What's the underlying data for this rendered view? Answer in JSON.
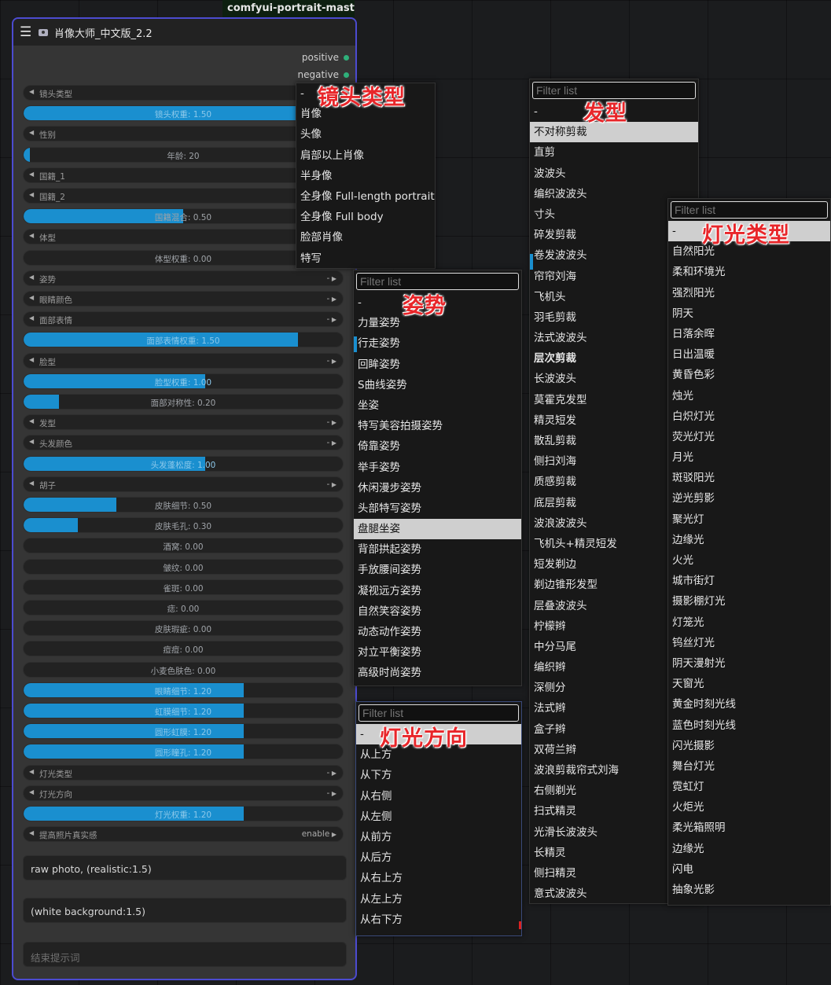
{
  "group_title": "comfyui-portrait-master..",
  "node": {
    "title": "肖像大师_中文版_2.2",
    "outputs": [
      "positive",
      "negative"
    ],
    "widgets": [
      {
        "type": "combo",
        "label": "镜头类型",
        "value": ""
      },
      {
        "type": "slider",
        "label": "镜头权重: 1.50",
        "fill": 0.86
      },
      {
        "type": "combo",
        "label": "性别",
        "value": ""
      },
      {
        "type": "slider",
        "label": "年龄: 20",
        "fill": 0.02
      },
      {
        "type": "combo",
        "label": "国籍_1",
        "value": ""
      },
      {
        "type": "combo",
        "label": "国籍_2",
        "value": ""
      },
      {
        "type": "slider",
        "label": "国籍混合: 0.50",
        "fill": 0.5
      },
      {
        "type": "combo",
        "label": "体型",
        "value": ""
      },
      {
        "type": "slider",
        "label": "体型权重: 0.00",
        "fill": 0
      },
      {
        "type": "combo",
        "label": "姿势",
        "value": "-"
      },
      {
        "type": "combo",
        "label": "眼睛颜色",
        "value": "-"
      },
      {
        "type": "combo",
        "label": "面部表情",
        "value": "-"
      },
      {
        "type": "slider",
        "label": "面部表情权重: 1.50",
        "fill": 0.86
      },
      {
        "type": "combo",
        "label": "脸型",
        "value": "-"
      },
      {
        "type": "slider",
        "label": "脸型权重: 1.00",
        "fill": 0.57
      },
      {
        "type": "slider",
        "label": "面部对称性: 0.20",
        "fill": 0.11
      },
      {
        "type": "combo",
        "label": "发型",
        "value": "-"
      },
      {
        "type": "combo",
        "label": "头发颜色",
        "value": "-"
      },
      {
        "type": "slider",
        "label": "头发蓬松度: 1.00",
        "fill": 0.57
      },
      {
        "type": "combo",
        "label": "胡子",
        "value": "-"
      },
      {
        "type": "slider",
        "label": "皮肤细节: 0.50",
        "fill": 0.29
      },
      {
        "type": "slider",
        "label": "皮肤毛孔: 0.30",
        "fill": 0.17
      },
      {
        "type": "slider",
        "label": "酒窝: 0.00",
        "fill": 0
      },
      {
        "type": "slider",
        "label": "皱纹: 0.00",
        "fill": 0
      },
      {
        "type": "slider",
        "label": "雀斑: 0.00",
        "fill": 0
      },
      {
        "type": "slider",
        "label": "痣: 0.00",
        "fill": 0
      },
      {
        "type": "slider",
        "label": "皮肤瑕疵: 0.00",
        "fill": 0
      },
      {
        "type": "slider",
        "label": "痘痘: 0.00",
        "fill": 0
      },
      {
        "type": "slider",
        "label": "小麦色肤色: 0.00",
        "fill": 0
      },
      {
        "type": "slider",
        "label": "眼睛细节: 1.20",
        "fill": 0.69
      },
      {
        "type": "slider",
        "label": "虹膜细节: 1.20",
        "fill": 0.69
      },
      {
        "type": "slider",
        "label": "圆形虹膜: 1.20",
        "fill": 0.69
      },
      {
        "type": "slider",
        "label": "圆形瞳孔: 1.20",
        "fill": 0.69
      },
      {
        "type": "combo",
        "label": "灯光类型",
        "value": "-"
      },
      {
        "type": "combo",
        "label": "灯光方向",
        "value": "-"
      },
      {
        "type": "slider",
        "label": "灯光权重: 1.20",
        "fill": 0.69
      },
      {
        "type": "combo",
        "label": "提高照片真实感",
        "value": "enable"
      }
    ],
    "prompt_start": "raw photo, (realistic:1.5)",
    "prompt_additional": "(white background:1.5)",
    "prompt_end_placeholder": "结束提示词"
  },
  "menus": {
    "shot": {
      "items": [
        "-",
        "肖像",
        "头像",
        "肩部以上肖像",
        "半身像",
        "全身像 Full-length portrait",
        "全身像 Full body",
        "脸部肖像",
        "特写"
      ]
    },
    "pose": {
      "filter": "Filter list",
      "items": [
        "-",
        "力量姿势",
        "行走姿势",
        "回眸姿势",
        "S曲线姿势",
        "坐姿",
        "特写美容拍摄姿势",
        "倚靠姿势",
        "举手姿势",
        "休闲漫步姿势",
        "头部特写姿势",
        "盘腿坐姿",
        "背部拱起姿势",
        "手放腰间姿势",
        "凝视远方姿势",
        "自然笑容姿势",
        "动态动作姿势",
        "对立平衡姿势",
        "高级时尚姿势"
      ],
      "selected": "盘腿坐姿"
    },
    "light_dir": {
      "filter": "Filter list",
      "items": [
        "-",
        "从上方",
        "从下方",
        "从右侧",
        "从左侧",
        "从前方",
        "从后方",
        "从右上方",
        "从左上方",
        "从右下方"
      ],
      "selected": "-"
    },
    "hair": {
      "filter": "Filter list",
      "items": [
        "-",
        "不对称剪裁",
        "直剪",
        "波波头",
        "编织波波头",
        "寸头",
        "碎发剪裁",
        "卷发波波头",
        "帘帘刘海",
        "飞机头",
        "羽毛剪裁",
        "法式波波头",
        "层次剪裁",
        "长波波头",
        "莫霍克发型",
        "精灵短发",
        "散乱剪裁",
        "侧扫刘海",
        "质感剪裁",
        "底层剪裁",
        "波浪波波头",
        "飞机头+精灵短发",
        "短发剃边",
        "剃边锥形发型",
        "层叠波波头",
        "柠檬辫",
        "中分马尾",
        "编织辫",
        "深侧分",
        "法式辫",
        "盒子辫",
        "双荷兰辫",
        "波浪剪裁帘式刘海",
        "右侧剃光",
        "扫式精灵",
        "光滑长波波头",
        "长精灵",
        "侧扫精灵",
        "意式波波头"
      ],
      "selected": "不对称剪裁",
      "bold": "层次剪裁"
    },
    "light_type": {
      "filter": "Filter list",
      "items": [
        "-",
        "自然阳光",
        "柔和环境光",
        "强烈阳光",
        "阴天",
        "日落余晖",
        "日出温暖",
        "黄昏色彩",
        "烛光",
        "白炽灯光",
        "荧光灯光",
        "月光",
        "斑驳阳光",
        "逆光剪影",
        "聚光灯",
        "边缘光",
        "火光",
        "城市街灯",
        "摄影棚灯光",
        "灯笼光",
        "钨丝灯光",
        "阴天漫射光",
        "天窗光",
        "黄金时刻光线",
        "蓝色时刻光线",
        "闪光摄影",
        "舞台灯光",
        "霓虹灯",
        "火炬光",
        "柔光箱照明",
        "边缘光",
        "闪电",
        "抽象光影"
      ],
      "selected": "-"
    }
  },
  "annotations": {
    "shot": "镜头类型",
    "pose": "姿势",
    "light_dir": "灯光方向",
    "hair": "发型",
    "light_type": "灯光类型"
  },
  "colors": {
    "accent": "#1a8fcf",
    "node_border": "#4c4bd0",
    "annotation": "#e8262a",
    "output_dot": "#2fb07a"
  }
}
